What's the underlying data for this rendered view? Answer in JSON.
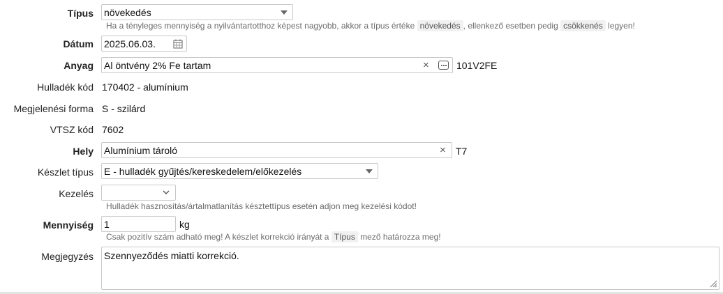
{
  "labels": {
    "tipus": "Típus",
    "datum": "Dátum",
    "anyag": "Anyag",
    "hulladek_kod": "Hulladék kód",
    "megjelenesi_forma": "Megjelenési forma",
    "vtsz_kod": "VTSZ kód",
    "hely": "Hely",
    "keszlet_tipus": "Készlet típus",
    "kezeles": "Kezelés",
    "mennyiseg": "Mennyiség",
    "megjegyzes": "Megjegyzés"
  },
  "tipus": {
    "value": "növekedés",
    "help_prefix": "Ha a tényleges mennyiség a nyilvántartotthoz képest nagyobb, akkor a típus értéke",
    "help_chip1": "növekedés",
    "help_middle": ", ellenkező esetben pedig",
    "help_chip2": "csökkenés",
    "help_suffix": "legyen!"
  },
  "datum": {
    "value": "2025.06.03."
  },
  "anyag": {
    "value": "Al öntvény 2% Fe tartam",
    "code": "101V2FE"
  },
  "hulladek_kod": {
    "value": "170402 - alumínium"
  },
  "megjelenesi_forma": {
    "value": "S - szilárd"
  },
  "vtsz_kod": {
    "value": "7602"
  },
  "hely": {
    "value": "Alumínium tároló",
    "code": "T7"
  },
  "keszlet_tipus": {
    "value": "E - hulladék gyűjtés/kereskedelem/előkezelés"
  },
  "kezeles": {
    "value": "",
    "help": "Hulladék hasznosítás/ártalmatlanítás késztettípus esetén adjon meg kezelési kódot!"
  },
  "mennyiseg": {
    "value": "1",
    "unit": "kg",
    "help_prefix": "Csak pozitív szám adható meg! A készlet korrekció irányát a",
    "help_chip": "Típus",
    "help_suffix": "mező határozza meg!"
  },
  "megjegyzes": {
    "value": "Szennyeződés miatti korrekció."
  },
  "icons": {
    "dropdown": "chevron-down-icon",
    "calendar": "calendar-icon",
    "clear": "close-icon",
    "more": "ellipsis-icon",
    "resize": "resize-handle-icon"
  }
}
